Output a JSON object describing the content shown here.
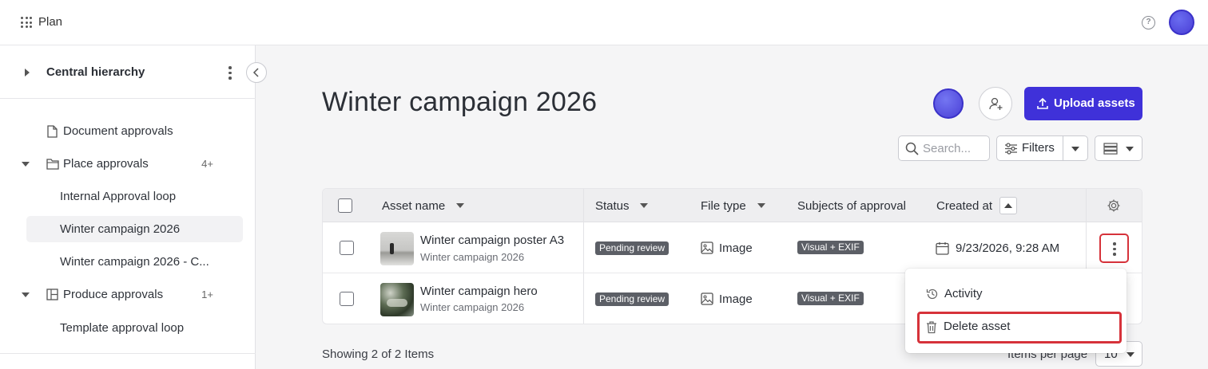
{
  "app": {
    "title": "Plan"
  },
  "sidebar": {
    "header_title": "Central hierarchy",
    "items": [
      {
        "label": "Document approvals",
        "badge": ""
      },
      {
        "label": "Place approvals",
        "badge": "4+"
      },
      {
        "label": "Internal Approval loop",
        "badge": ""
      },
      {
        "label": "Winter campaign 2026",
        "badge": ""
      },
      {
        "label": "Winter campaign 2026 - C...",
        "badge": ""
      },
      {
        "label": "Produce approvals",
        "badge": "1+"
      },
      {
        "label": "Template approval loop",
        "badge": ""
      }
    ]
  },
  "page": {
    "title": "Winter campaign 2026",
    "upload_label": "Upload assets",
    "search_placeholder": "Search...",
    "filters_label": "Filters"
  },
  "table": {
    "columns": [
      "Asset name",
      "Status",
      "File type",
      "Subjects of approval",
      "Created at"
    ],
    "rows": [
      {
        "name": "Winter campaign poster A3",
        "folder": "Winter campaign 2026",
        "status": "Pending review",
        "file_type": "Image",
        "subjects": "Visual + EXIF",
        "created": "9/23/2026, 9:28 AM"
      },
      {
        "name": "Winter campaign hero",
        "folder": "Winter campaign 2026",
        "status": "Pending review",
        "file_type": "Image",
        "subjects": "Visual + EXIF",
        "created": ""
      }
    ]
  },
  "menu": {
    "items": [
      "Activity",
      "Delete asset"
    ]
  },
  "footer": {
    "showing": "Showing 2 of 2 Items",
    "items_per_page_label": "Items per page",
    "items_per_page_value": "10"
  },
  "colors": {
    "accent": "#3f31d9",
    "danger": "#d6323a",
    "badge_bg": "#5c5f66"
  },
  "icons": [
    "apps-grid-icon",
    "help-icon",
    "caret-right-icon",
    "kebab-icon",
    "chevron-left-icon",
    "document-icon",
    "folder-icon",
    "layout-icon",
    "add-user-icon",
    "upload-icon",
    "search-icon",
    "sliders-icon",
    "list-view-icon",
    "gear-icon",
    "image-icon",
    "calendar-icon",
    "history-icon",
    "trash-icon"
  ]
}
